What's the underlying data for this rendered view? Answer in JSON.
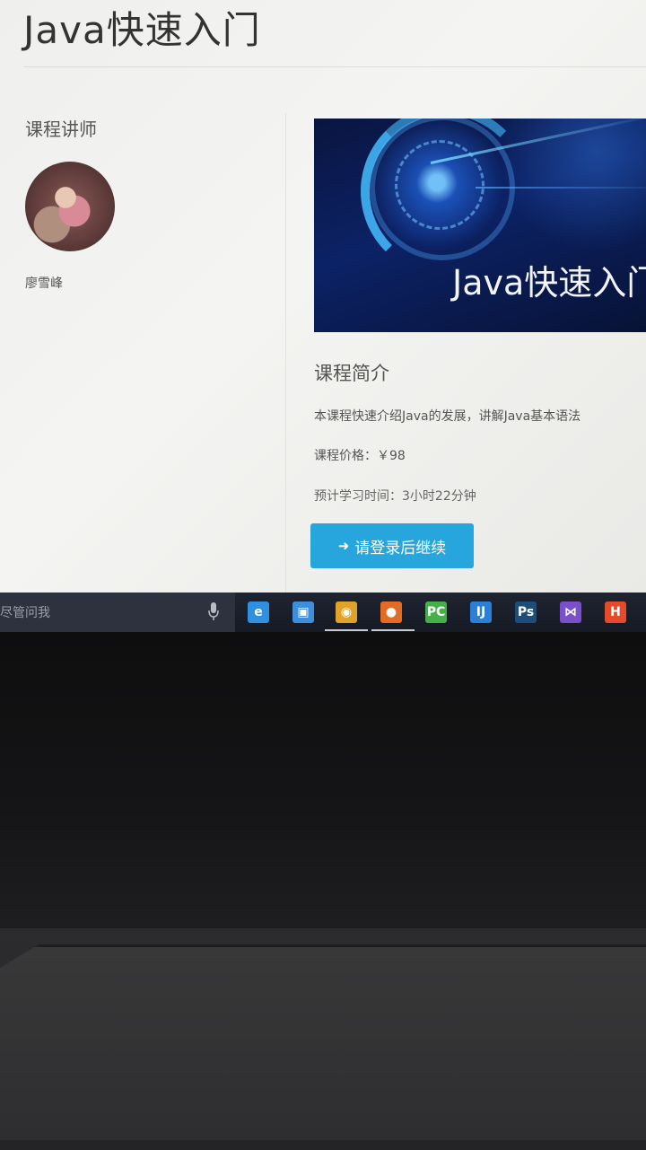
{
  "page": {
    "title": "Java快速入门",
    "instructor_heading": "课程讲师",
    "instructor_name": "廖雪峰",
    "banner_text": "Java快速入门",
    "intro_heading": "课程简介",
    "intro_text": "本课程快速介绍Java的发展，讲解Java基本语法",
    "price": "课程价格：￥98",
    "duration": "预计学习时间：3小时22分钟",
    "login_button": "请登录后继续",
    "login_icon": "sign-in-icon"
  },
  "taskbar": {
    "search_text": "尽管问我",
    "apps": [
      {
        "name": "edge-icon",
        "glyph": "e",
        "color": "#2f8fe0"
      },
      {
        "name": "media-player-icon",
        "glyph": "▣",
        "color": "#3c8fd8"
      },
      {
        "name": "chrome-icon",
        "glyph": "◉",
        "color": "#e0a32a"
      },
      {
        "name": "firefox-icon",
        "glyph": "●",
        "color": "#e36b25"
      },
      {
        "name": "pycharm-icon",
        "glyph": "PC",
        "color": "#45b04a"
      },
      {
        "name": "jetbrains-icon",
        "glyph": "IJ",
        "color": "#2c7fd6"
      },
      {
        "name": "photoshop-icon",
        "glyph": "Ps",
        "color": "#1d4d7a"
      },
      {
        "name": "visual-studio-icon",
        "glyph": "⋈",
        "color": "#7a4fc9"
      },
      {
        "name": "html-editor-icon",
        "glyph": "H",
        "color": "#e34b2c"
      }
    ]
  }
}
